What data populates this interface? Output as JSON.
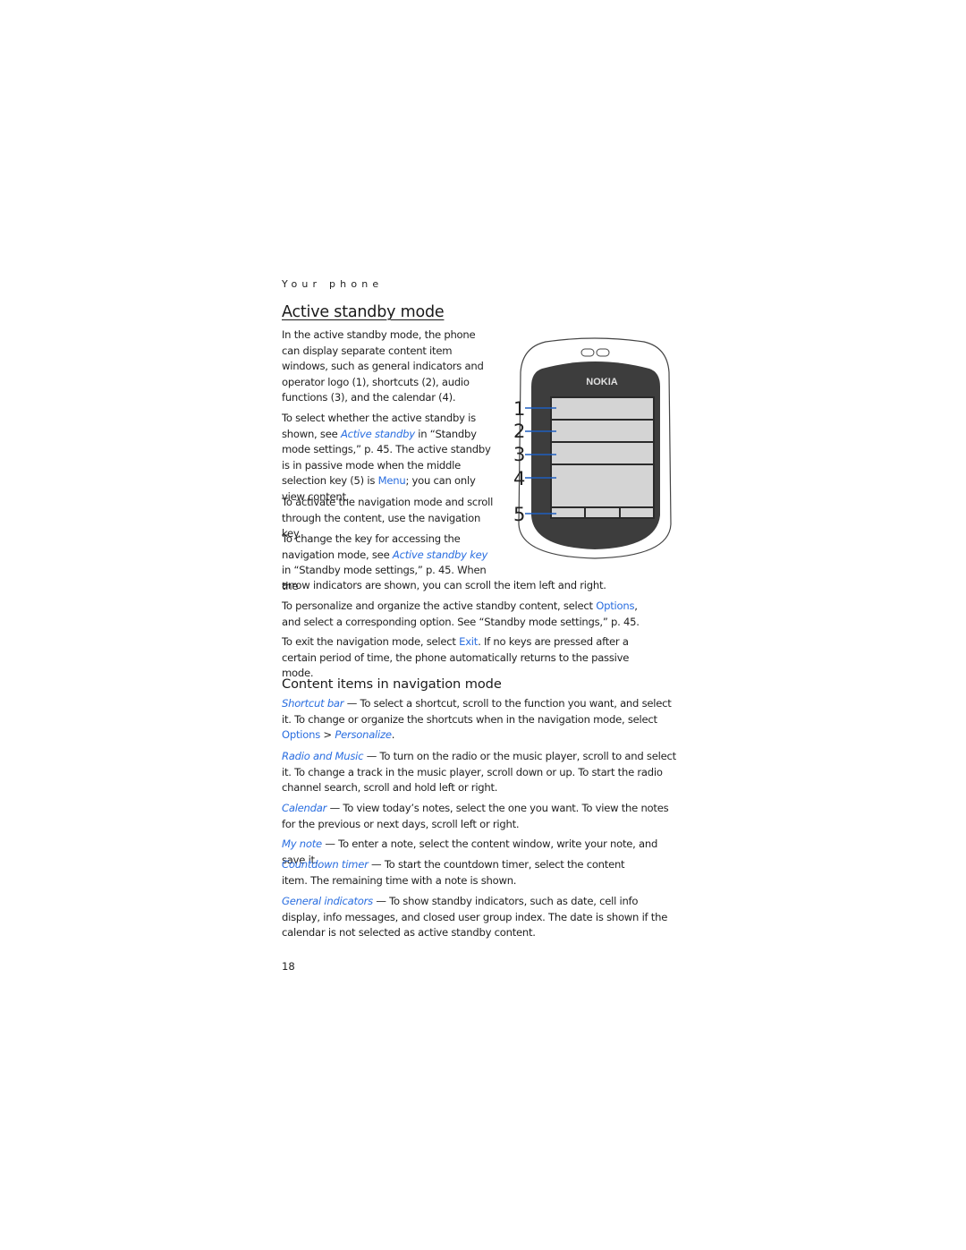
{
  "running_head": "Your phone",
  "section": {
    "title": "Active standby mode",
    "intro": "In the active standby mode, the phone can display separate content item windows, such as general indicators and operator logo (1), shortcuts (2), audio functions (3), and the calendar (4).",
    "p2": {
      "a": "To select whether the active standby is shown, see ",
      "link": "Active standby",
      "b": " in “Standby mode settings,” p. 45. The active standby is in passive mode when the middle selection key (5) is ",
      "key": "Menu",
      "c": "; you can only view content."
    },
    "p3": "To activate the navigation mode and scroll through the content, use the navigation key.",
    "p4": {
      "a": "To change the key for accessing the navigation mode, see ",
      "link": "Active standby key",
      "b": " in “Standby mode settings,” p. 45. When the",
      "c": "arrow indicators are shown, you can scroll the item left and right."
    },
    "p5": {
      "a": "To personalize and organize the active standby content, select ",
      "key": "Options",
      "b": ", and select a corresponding option. See “Standby mode settings,” p. 45."
    },
    "p6": {
      "a": "To exit the navigation mode, select ",
      "key": "Exit",
      "b": ". If no keys are pressed after a certain period of time, the phone automatically returns to the passive mode."
    }
  },
  "figure": {
    "brand": "NOKIA",
    "callouts": [
      "1",
      "2",
      "3",
      "4",
      "5"
    ]
  },
  "subsection": {
    "title": "Content items in navigation mode",
    "items": [
      {
        "term": "Shortcut bar",
        "text": " — To select a shortcut, scroll to the function you want, and select it. To change or organize the shortcuts when in the navigation mode, select ",
        "key": "Options",
        "sep": " > ",
        "path": "Personalize",
        "end": "."
      },
      {
        "term": "Radio and Music",
        "text": " — To turn on the radio or the music player, scroll to and select it. To change a track in the music player, scroll down or up. To start the radio channel search, scroll and hold left or right."
      },
      {
        "term": "Calendar",
        "text": " — To view today’s notes, select the one you want. To view the notes for the previous or next days, scroll left or right."
      },
      {
        "term": "My note",
        "text": " — To enter a note, select the content window, write your note, and save it."
      },
      {
        "term": "Countdown timer",
        "text": " — To start the countdown timer, select the content item. The remaining time with a note is shown."
      },
      {
        "term": "General indicators",
        "text": " — To show standby indicators, such as date, cell info display, info messages, and closed user group index. The date is shown if the calendar is not selected as active standby content."
      }
    ]
  },
  "page_number": "18",
  "colors": {
    "link": "#2a6ee0",
    "phone_body": "#3d3d3d",
    "screen": "#d4d4d4",
    "callout_line": "#1f5fbf"
  }
}
